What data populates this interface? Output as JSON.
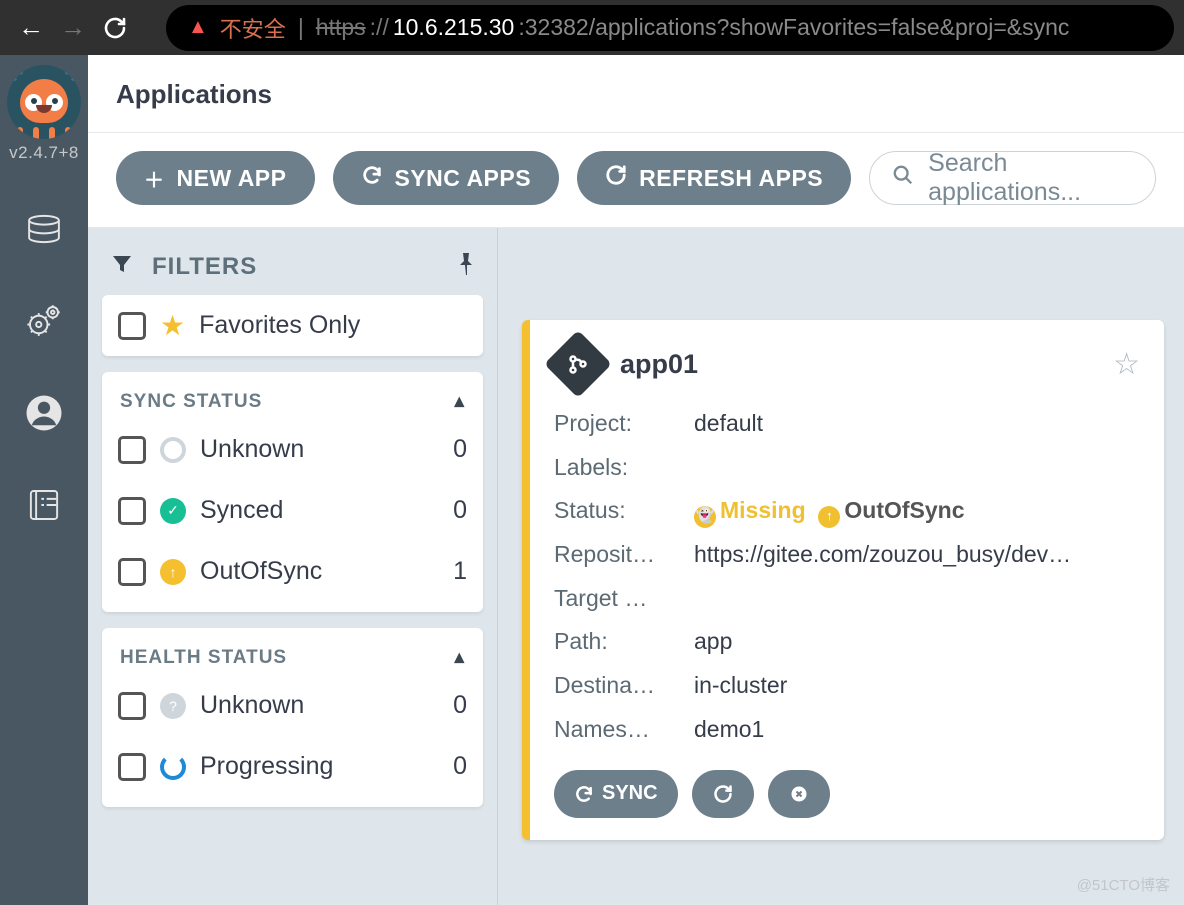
{
  "browser": {
    "not_secure": "不安全",
    "scheme": "https",
    "host": "10.6.215.30",
    "port_path": ":32382/applications?showFavorites=false&proj=&sync"
  },
  "side": {
    "version": "v2.4.7+8"
  },
  "header": {
    "title": "Applications"
  },
  "toolbar": {
    "new_app": "NEW APP",
    "sync_apps": "SYNC APPS",
    "refresh_apps": "REFRESH APPS",
    "search_placeholder": "Search applications..."
  },
  "filters": {
    "label": "FILTERS",
    "favorites": "Favorites Only",
    "sync_status_label": "SYNC STATUS",
    "sync": [
      {
        "label": "Unknown",
        "count": "0"
      },
      {
        "label": "Synced",
        "count": "0"
      },
      {
        "label": "OutOfSync",
        "count": "1"
      }
    ],
    "health_status_label": "HEALTH STATUS",
    "health": [
      {
        "label": "Unknown",
        "count": "0"
      },
      {
        "label": "Progressing",
        "count": "0"
      }
    ]
  },
  "app": {
    "name": "app01",
    "rows": {
      "project": {
        "k": "Project:",
        "v": "default"
      },
      "labels": {
        "k": "Labels:",
        "v": ""
      },
      "status": {
        "k": "Status:",
        "miss": "Missing",
        "out": "OutOfSync"
      },
      "repo": {
        "k": "Reposit…",
        "v": "https://gitee.com/zouzou_busy/dev…"
      },
      "target": {
        "k": "Target …",
        "v": ""
      },
      "path": {
        "k": "Path:",
        "v": "app"
      },
      "dest": {
        "k": "Destina…",
        "v": "in-cluster"
      },
      "ns": {
        "k": "Names…",
        "v": "demo1"
      }
    },
    "actions": {
      "sync": "SYNC"
    }
  },
  "watermark": "@51CTO博客"
}
